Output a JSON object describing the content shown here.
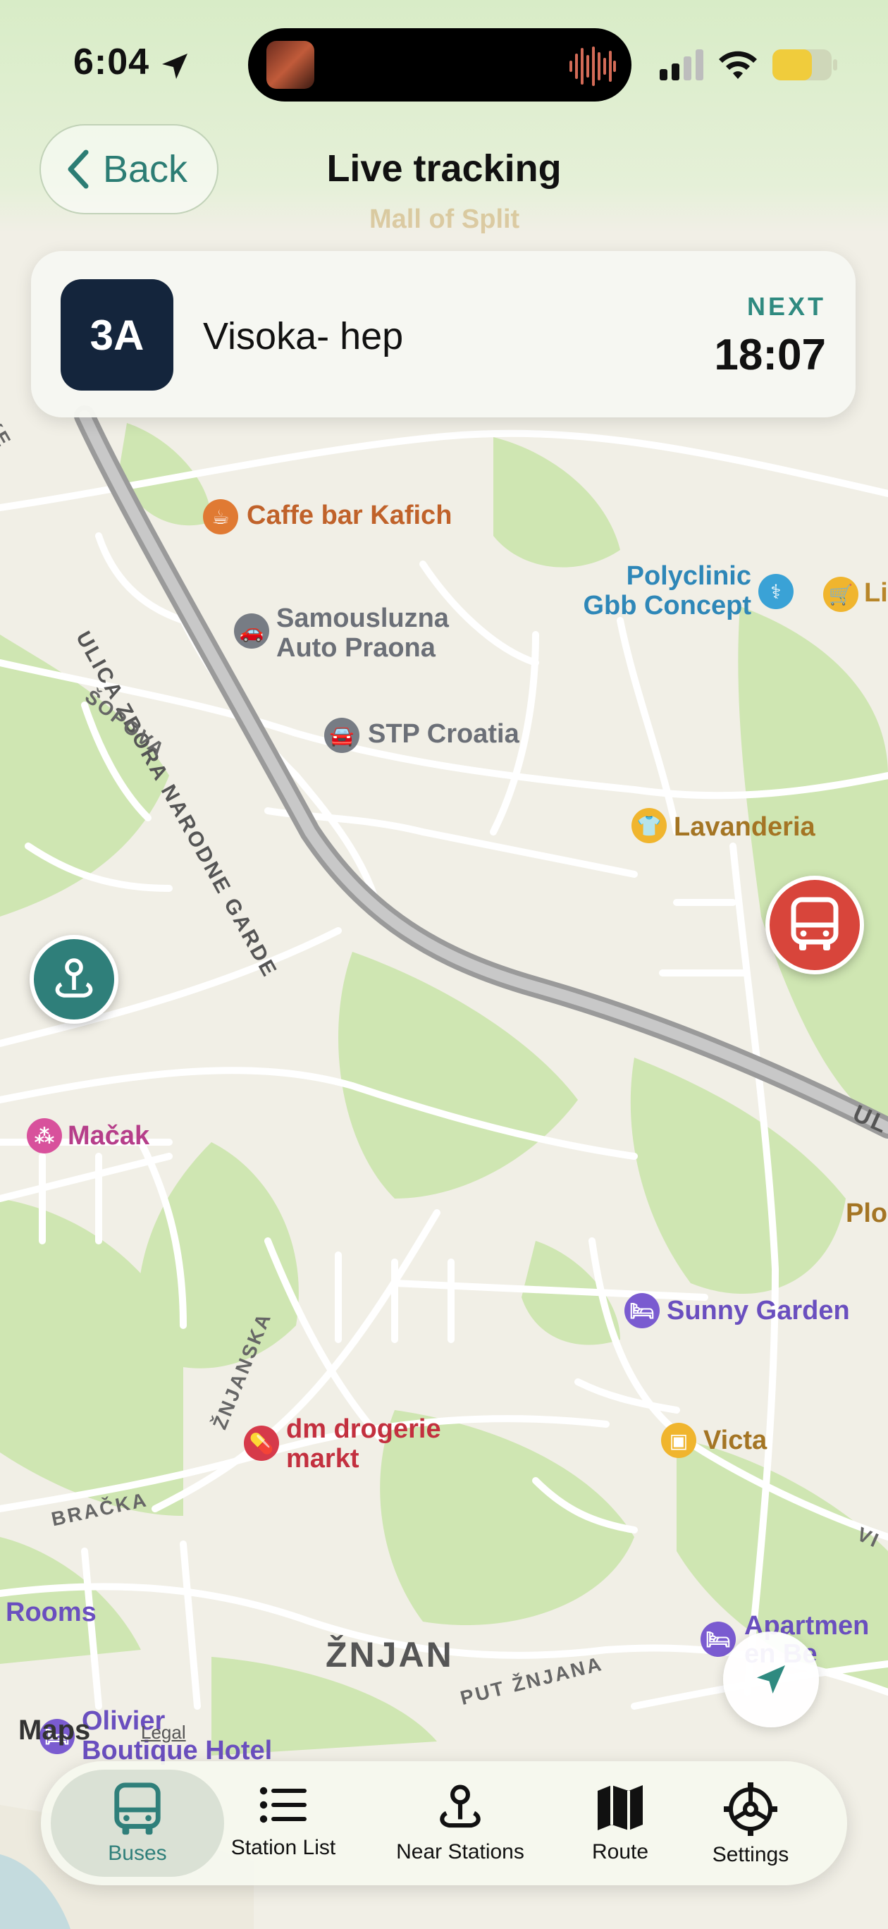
{
  "status_bar": {
    "time": "6:04"
  },
  "header": {
    "back_label": "Back",
    "title": "Live tracking"
  },
  "route_card": {
    "route_number": "3A",
    "route_name": "Visoka- hep",
    "next_label": "NEXT",
    "next_time": "18:07"
  },
  "map": {
    "pois": [
      {
        "name": "Caffe bar Kafich",
        "color": "#c0622a"
      },
      {
        "name": "Samousluzna",
        "name2": "Auto Praona",
        "color": "#6b6f77"
      },
      {
        "name": "STP Croatia",
        "color": "#6b6f77"
      },
      {
        "name": "Polyclinic",
        "name2": "Gbb Concept",
        "color": "#2e87b8"
      },
      {
        "name": "Li",
        "color": "#b8862a"
      },
      {
        "name": "Lavanderia",
        "color": "#a47524"
      },
      {
        "name": "Mačak",
        "color": "#b63e8a"
      },
      {
        "name": "Sunny Garden",
        "color": "#6a4fbf"
      },
      {
        "name": "dm drogerie",
        "name2": "markt",
        "color": "#c3303f"
      },
      {
        "name": "Victa",
        "color": "#a47524"
      },
      {
        "name": "Rooms",
        "color": "#6a4fbf"
      },
      {
        "name": "Apartmen",
        "name2": "en Be",
        "color": "#6a4fbf"
      },
      {
        "name": "Olivier",
        "name2": "Boutique Hotel",
        "color": "#6a4fbf"
      },
      {
        "name": "Plo",
        "color": "#a47524"
      },
      {
        "name": "Mall of Split",
        "color": "#b8862a"
      }
    ],
    "streets": {
      "zbora": "ULICA ZBORA NARODNE GARDE",
      "sopova": "ŠOPOVA",
      "znjanska": "ŽNJANSKA",
      "bracka": "BRAČKA",
      "put_znjana": "PUT ŽNJANA",
      "ul": "UL",
      "vi": "VI",
      "ke": "KE"
    },
    "district": "ŽNJAN",
    "attribution": "Maps",
    "legal": "Legal"
  },
  "tabs": [
    {
      "label": "Buses",
      "icon": "bus-icon",
      "active": true
    },
    {
      "label": "Station List",
      "icon": "list-icon",
      "active": false
    },
    {
      "label": "Near Stations",
      "icon": "location-pin-icon",
      "active": false
    },
    {
      "label": "Route",
      "icon": "map-icon",
      "active": false
    },
    {
      "label": "Settings",
      "icon": "gear-icon",
      "active": false
    }
  ],
  "colors": {
    "accent": "#2f8a80",
    "bus_marker": "#d8453b",
    "stop_marker": "#2f7f7a",
    "route_badge": "#14253c"
  }
}
